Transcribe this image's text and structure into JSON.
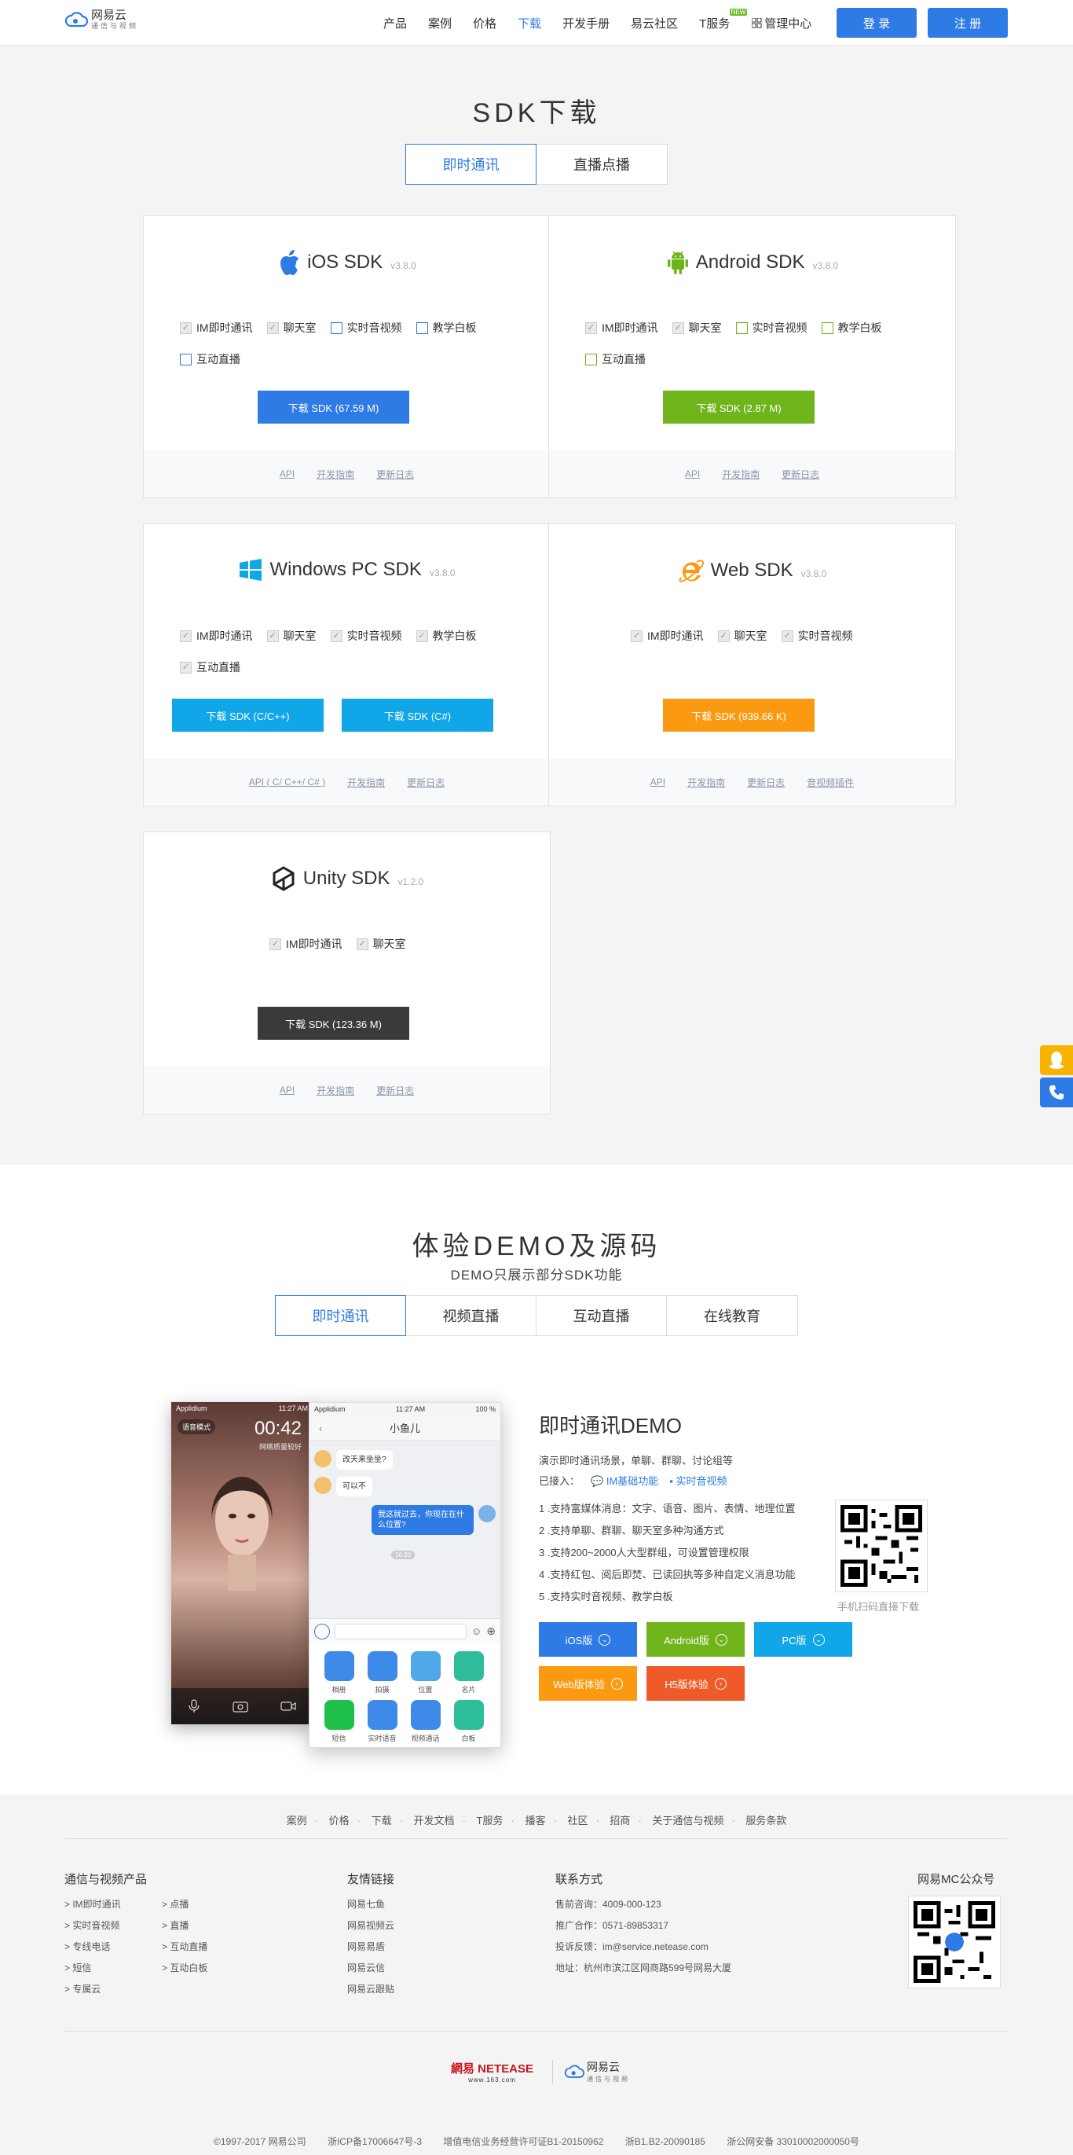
{
  "header": {
    "logo_name": "网易云",
    "logo_sub": "通信与视频",
    "nav": [
      {
        "label": "产品",
        "active": false
      },
      {
        "label": "案例",
        "active": false
      },
      {
        "label": "价格",
        "active": false
      },
      {
        "label": "下载",
        "active": true
      },
      {
        "label": "开发手册",
        "active": false
      },
      {
        "label": "易云社区",
        "active": false
      },
      {
        "label": "T服务",
        "active": false
      }
    ],
    "new_badge": "NEW",
    "manage_label": "管理中心",
    "login_label": "登 录",
    "register_label": "注 册"
  },
  "sdk": {
    "title": "SDK下载",
    "tabs": [
      "即时通讯",
      "直播点播"
    ],
    "active_tab": 0,
    "cards": [
      {
        "name": "iOS SDK",
        "version": "v3.8.0",
        "icon": "apple-icon",
        "options": [
          {
            "label": "IM即时通讯",
            "checked": true
          },
          {
            "label": "聊天室",
            "checked": true
          },
          {
            "label": "实时音视频",
            "checked": false
          },
          {
            "label": "教学白板",
            "checked": false
          },
          {
            "label": "互动直播",
            "checked": false
          }
        ],
        "buttons": [
          {
            "label": "下载 SDK (67.59 M)",
            "color": "#2f7be5"
          }
        ],
        "links": [
          "API",
          "开发指南",
          "更新日志"
        ]
      },
      {
        "name": "Android SDK",
        "version": "v3.8.0",
        "icon": "android-icon",
        "options": [
          {
            "label": "IM即时通讯",
            "checked": true
          },
          {
            "label": "聊天室",
            "checked": true
          },
          {
            "label": "实时音视频",
            "checked": false
          },
          {
            "label": "教学白板",
            "checked": false
          },
          {
            "label": "互动直播",
            "checked": false
          }
        ],
        "buttons": [
          {
            "label": "下载 SDK (2.87 M)",
            "color": "#6fb41a"
          }
        ],
        "links": [
          "API",
          "开发指南",
          "更新日志"
        ]
      },
      {
        "name": "Windows PC SDK",
        "version": "v3.8.0",
        "icon": "windows-icon",
        "options": [
          {
            "label": "IM即时通讯",
            "checked": true
          },
          {
            "label": "聊天室",
            "checked": true
          },
          {
            "label": "实时音视频",
            "checked": true
          },
          {
            "label": "教学白板",
            "checked": true
          },
          {
            "label": "互动直播",
            "checked": true
          }
        ],
        "buttons": [
          {
            "label": "下载 SDK (C/C++)",
            "color": "#11a6e8"
          },
          {
            "label": "下载 SDK (C#)",
            "color": "#11a6e8"
          }
        ],
        "links": [
          "API ( C/ C++/ C# )",
          "开发指南",
          "更新日志"
        ]
      },
      {
        "name": "Web SDK",
        "version": "v3.8.0",
        "icon": "ie-icon",
        "options": [
          {
            "label": "IM即时通讯",
            "checked": true
          },
          {
            "label": "聊天室",
            "checked": true
          },
          {
            "label": "实时音视频",
            "checked": true
          }
        ],
        "buttons": [
          {
            "label": "下载 SDK (939.66 K)",
            "color": "#fb9a10"
          }
        ],
        "links": [
          "API",
          "开发指南",
          "更新日志",
          "音视频插件"
        ]
      },
      {
        "name": "Unity SDK",
        "version": "v1.2.0",
        "icon": "unity-icon",
        "options": [
          {
            "label": "IM即时通讯",
            "checked": true
          },
          {
            "label": "聊天室",
            "checked": true
          }
        ],
        "buttons": [
          {
            "label": "下载 SDK (123.36 M)",
            "color": "#3a3a3a"
          }
        ],
        "links": [
          "API",
          "开发指南",
          "更新日志"
        ]
      }
    ]
  },
  "demo": {
    "title": "体验DEMO及源码",
    "subtitle": "DEMO只展示部分SDK功能",
    "tabs": [
      "即时通讯",
      "视频直播",
      "互动直播",
      "在线教育"
    ],
    "active_tab": 0,
    "heading": "即时通讯DEMO",
    "desc": "演示即时通讯场景，单聊、群聊、讨论组等",
    "joined_label": "已接入：",
    "joined": [
      "IM基础功能",
      "实时音视频"
    ],
    "features": [
      "1 .支持富媒体消息：文字、语音、图片、表情、地理位置",
      "2 .支持单聊、群聊、聊天室多种沟通方式",
      "3 .支持200~2000人大型群组，可设置管理权限",
      "4 .支持红包、阅后即焚、已读回执等多种自定义消息功能",
      "5 .支持实时音视频、教学白板"
    ],
    "qr_caption": "手机扫码直接下载",
    "buttons": [
      {
        "label": "iOS版",
        "color": "#2f7be5"
      },
      {
        "label": "Android版",
        "color": "#6fb41a"
      },
      {
        "label": "PC版",
        "color": "#11a6e8"
      },
      {
        "label": "Web版体验",
        "color": "#fb9a10"
      },
      {
        "label": "H5版体验",
        "color": "#f05a28"
      }
    ],
    "phone": {
      "carrier_left": "Applidium",
      "time_left": "11:27 AM",
      "voice_mode": "语音模式",
      "call_time": "00:42",
      "call_status": "网络质量较好",
      "carrier_right": "Applidium",
      "time_right": "11:27 AM",
      "battery": "100 %",
      "chat_title": "小鱼儿",
      "messages": [
        "改天来坐坐?",
        "可以不",
        "我这就过去，你现在在什么位置?"
      ],
      "msg_time": "16:20",
      "tools": [
        "相册",
        "拍摄",
        "位置",
        "名片",
        "短信",
        "实时语音",
        "视频通话",
        "白板"
      ]
    }
  },
  "footer": {
    "links": [
      "案例",
      "价格",
      "下载",
      "开发文档",
      "T服务",
      "播客",
      "社区",
      "招商",
      "关于通信与视频",
      "服务条款"
    ],
    "products_title": "通信与视频产品",
    "products_col1": [
      "IM即时通讯",
      "实时音视频",
      "专线电话",
      "短信",
      "专属云"
    ],
    "products_col2": [
      "点播",
      "直播",
      "互动直播",
      "互动白板"
    ],
    "friends_title": "友情链接",
    "friends": [
      "网易七鱼",
      "网易视频云",
      "网易易盾",
      "网易云信",
      "网易云跟贴"
    ],
    "contact_title": "联系方式",
    "contact": [
      "售前咨询：4009-000-123",
      "推广合作：0571-89853317",
      "投诉反馈：im@service.netease.com",
      "地址：杭州市滨江区网商路599号网易大厦"
    ],
    "wechat_title": "网易MC公众号",
    "netease_logo": "網易 NETEASE",
    "netease_sub": "www.163.com",
    "yunxin_logo": "网易云",
    "yunxin_sub": "通信与视频",
    "copyright": [
      "©1997-2017 网易公司",
      "浙ICP备17006647号-3",
      "增值电信业务经营许可证B1-20150962",
      "浙B1.B2-20090185",
      "浙公网安备 33010002000050号"
    ]
  }
}
